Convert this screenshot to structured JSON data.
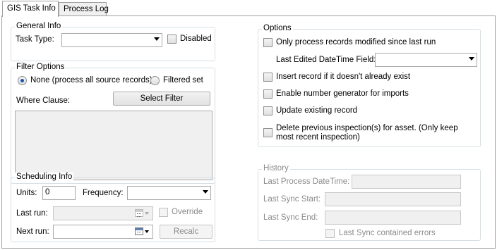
{
  "tabs": [
    {
      "label": "GIS Task Info",
      "active": true
    },
    {
      "label": "Process Log",
      "active": false
    }
  ],
  "general_info": {
    "title": "General Info",
    "task_type_label": "Task Type:",
    "task_type_value": "",
    "disabled_label": "Disabled",
    "disabled_checked": false
  },
  "filter_options": {
    "title": "Filter Options",
    "none_label": "None (process all source records)",
    "filtered_label": "Filtered set",
    "selected": "none",
    "where_clause_label": "Where Clause:",
    "select_filter_label": "Select Filter",
    "where_clause_value": ""
  },
  "scheduling_info": {
    "title": "Scheduling Info",
    "units_label": "Units:",
    "units_value": "0",
    "frequency_label": "Frequency:",
    "frequency_value": "",
    "last_run_label": "Last run:",
    "last_run_value": "",
    "override_label": "Override",
    "next_run_label": "Next run:",
    "next_run_value": "",
    "recalc_label": "Recalc"
  },
  "options": {
    "title": "Options",
    "only_modified_label": "Only process records modified since last run",
    "last_edited_label": "Last Edited DateTime Field:",
    "last_edited_value": "",
    "insert_record_label": "Insert record if it doesn't already exist",
    "enable_number_label": "Enable number generator for imports",
    "update_existing_label": "Update existing record",
    "delete_previous_line1": "Delete previous inspection(s) for asset.  (Only keep",
    "delete_previous_line2": "most recent inspection)"
  },
  "history": {
    "title": "History",
    "last_process_label": "Last Process DateTime:",
    "last_sync_start_label": "Last Sync Start:",
    "last_sync_end_label": "Last Sync End:",
    "last_sync_errors_label": "Last Sync contained errors",
    "last_process_value": "",
    "last_sync_start_value": "",
    "last_sync_end_value": ""
  },
  "colors": {
    "group_border": "#d5dfe5",
    "radio_dot": "#1a56a8",
    "disabled_text": "#8a8a8a"
  }
}
